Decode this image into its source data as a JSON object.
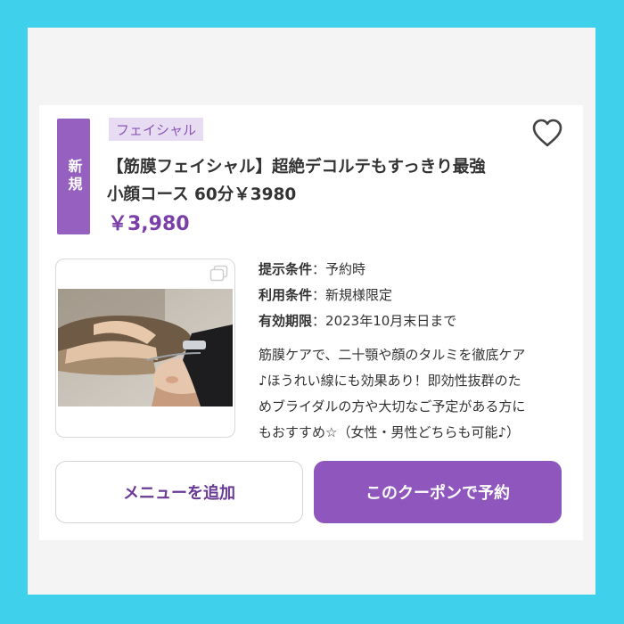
{
  "coupon": {
    "new_badge": "新規",
    "category": "フェイシャル",
    "title_line1": "【筋膜フェイシャル】超絶デコルテもすっきり最強",
    "title_line2": "小顔コース 60分￥3980",
    "price": "￥3,980",
    "conditions": [
      {
        "label": "提示条件",
        "sep": "：",
        "value": "予約時"
      },
      {
        "label": "利用条件",
        "sep": "：",
        "value": "新規様限定"
      },
      {
        "label": "有効期限",
        "sep": "：",
        "value": "2023年10月末日まで"
      }
    ],
    "description_lines": [
      "筋膜ケアで、二十顎や顔のタルミを徹底ケア",
      "♪ほうれい線にも効果あり！即効性抜群のた",
      "めブライダルの方や大切なご予定がある方に",
      "もおすすめ☆（女性・男性どちらも可能♪）"
    ],
    "buttons": {
      "add_menu": "メニューを追加",
      "reserve": "このクーポンで予約"
    }
  },
  "colors": {
    "outer_border": "#3fd0ec",
    "accent": "#8f57bd",
    "price": "#7b3fa8",
    "tag_bg": "#e8dcf3"
  },
  "icons": [
    "heart-icon",
    "copy-icon"
  ]
}
